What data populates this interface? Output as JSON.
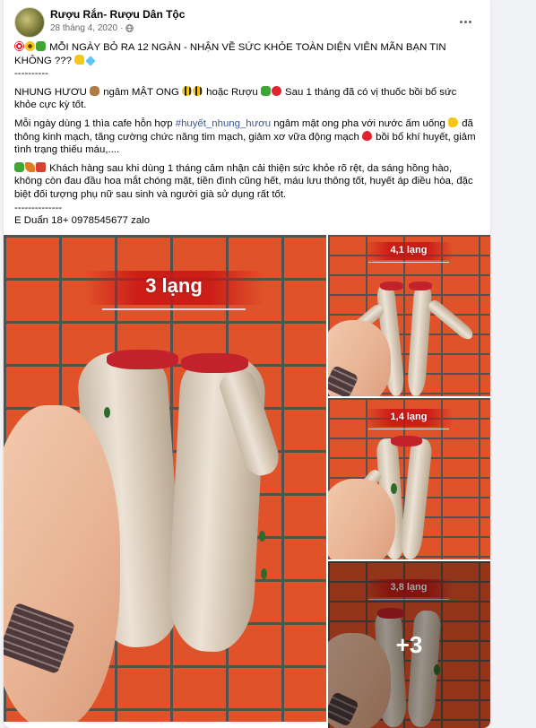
{
  "post": {
    "page_name": "Rượu Rắn- Rượu Dân Tộc",
    "date": "28 tháng 4, 2020",
    "separator": "·",
    "privacy_icon": "globe-icon",
    "more_icon": "more-options-icon"
  },
  "text": {
    "line1": "MỖI NGÀY BỎ RA 12 NGÀN - NHẬN VỀ SỨC KHỎE TOÀN DIỆN VIÊN MÃN BẠN TIN KHÔNG ???",
    "divider1": "----------",
    "p2_a": "NHUNG HƯƠU",
    "p2_b": "ngâm MẬT ONG",
    "p2_c": "hoặc Rượu",
    "p2_d": "Sau 1 tháng đã có vị thuốc bồi bổ sức khỏe cực kỳ tốt.",
    "p3_a": "Mỗi ngày dùng 1 thìa cafe hỗn hợp",
    "p3_hashtag": "#huyết_nhung_hươu",
    "p3_b": "ngâm mật ong pha với nước ấm uống",
    "p3_c": "đã thông kinh mạch, tăng cường chức năng tim mạch, giảm xơ vữa động mạch",
    "p3_d": "bồi bổ khí huyết, giảm tình trạng thiếu máu,....",
    "p4": "Khách hàng sau khi dùng 1 tháng cảm nhận cải thiện sức khỏe rõ rệt, da sáng hồng hào, không còn đau đầu hoa mắt chóng mặt, tiền đình cũng hết, máu lưu thông tốt, huyết áp điều hòa, đặc biệt đối tượng phụ nữ sau sinh và người già sử dụng rất tốt.",
    "divider2": "--------------",
    "contact": "E Duẩn 18+ 0978545677 zalo"
  },
  "photos": {
    "main_label": "3 lạng",
    "thumb1_label": "4,1 lạng",
    "thumb2_label": "1,4 lạng",
    "thumb3_label": "3,8 lạng",
    "more_count": "+3"
  },
  "colors": {
    "brick": "#e0522a",
    "mortar": "#54524e",
    "hashtag": "#385898",
    "meta": "#65676b"
  }
}
